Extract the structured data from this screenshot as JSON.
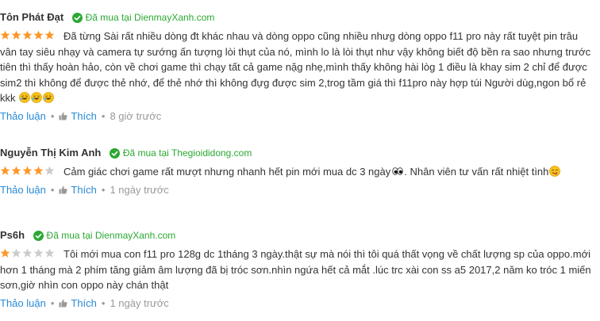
{
  "colors": {
    "star": "#fd9727",
    "star_empty": "#cccccc",
    "verified": "#2ba832",
    "link": "#288ad6",
    "muted": "#999999",
    "text": "#333333"
  },
  "reviews": [
    {
      "name": "Tôn Phát Đạt",
      "verified": "Đã mua tại DienmayXanh.com",
      "rating": 5,
      "text": "Đã từng Sài rất nhiều dòng đt khác nhau và dòng oppo cũng nhiều nhưg dòng oppo f11 pro này rất tuyệt pin trâu vân tay siêu nhạy và camera tự sướng ấn tượng lòi thụt của nó, mình lo là lòi thụt như vậy không biết độ bền ra sao nhưng trước tiên thì thấy hoàn hảo, còn về chơi game thì chạy tất cả game nặg nhẹ,mình thấy không hài lòg 1 điều là khay sim 2 chỉ để được sim2 thì không để được thẻ nhớ, để thẻ nhớ thì không đựg được sim 2,trog tầm giá thì f11pro này hợp túi Người dùg,ngon bổ rẻ kkk",
      "emojis": [
        "rofl",
        "rofl",
        "rofl"
      ],
      "discuss": "Thảo luận",
      "like": "Thích",
      "time": "8 giờ trước"
    },
    {
      "name": "Nguyễn Thị Kim Anh",
      "verified": "Đã mua tại Thegioididong.com",
      "rating": 4,
      "text": "Cảm giác chơi game rất mượt nhưng nhanh hết pin mới mua dc 3 ngày",
      "text_after_eyes": ". Nhân viên tư vấn rất nhiệt tình",
      "emojis": [
        "eyes",
        "yum"
      ],
      "discuss": "Thảo luận",
      "like": "Thích",
      "time": "1 ngày trước"
    },
    {
      "name": "Ps6h",
      "verified": "Đã mua tại DienmayXanh.com",
      "rating": 1,
      "text": "Tôi mới mua con f11 pro 128g dc 1tháng 3 ngày.thật sự mà nói thì tôi quá thất vọng về chất lượng sp của oppo.mới hơn 1 tháng mà 2 phím tăng giảm âm lượng đã bị tróc sơn.nhìn ngứa hết cả mắt .lúc trc xài con ss a5 2017,2 năm ko tróc 1 miến sơn,giờ nhìn con oppo này chán thật",
      "emojis": [],
      "discuss": "Thảo luận",
      "like": "Thích",
      "time": "1 ngày trước"
    }
  ]
}
